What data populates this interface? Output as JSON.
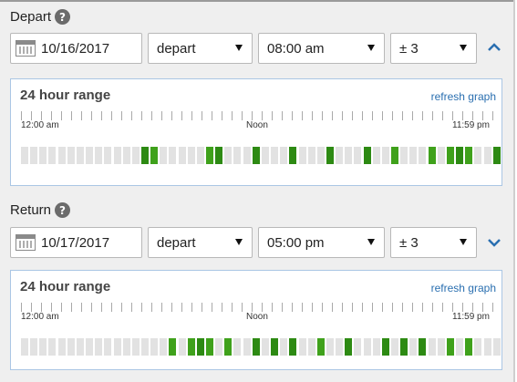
{
  "depart": {
    "label": "Depart",
    "help_icon": "?",
    "date": "10/16/2017",
    "mode": "depart",
    "time": "08:00 am",
    "range": "± 3",
    "toggle_icon": "chevron-up-icon",
    "graph": {
      "title": "24 hour range",
      "refresh_label": "refresh graph",
      "tick_start": "12:00 am",
      "tick_mid": "Noon",
      "tick_end": "11:59 pm",
      "active_slots": [
        13,
        14,
        20,
        21,
        25,
        29,
        33,
        37,
        40,
        44,
        46,
        47,
        48,
        51
      ]
    }
  },
  "return": {
    "label": "Return",
    "help_icon": "?",
    "date": "10/17/2017",
    "mode": "depart",
    "time": "05:00 pm",
    "range": "± 3",
    "toggle_icon": "chevron-down-icon",
    "graph": {
      "title": "24 hour range",
      "refresh_label": "refresh graph",
      "tick_start": "12:00 am",
      "tick_mid": "Noon",
      "tick_end": "11:59 pm",
      "active_slots": [
        16,
        18,
        19,
        20,
        22,
        25,
        27,
        29,
        32,
        35,
        39,
        41,
        43,
        46,
        48
      ]
    }
  },
  "colors": {
    "accent": "#2a6fb0",
    "available": "#3fa11b",
    "unavailable": "#e2e2e2"
  }
}
